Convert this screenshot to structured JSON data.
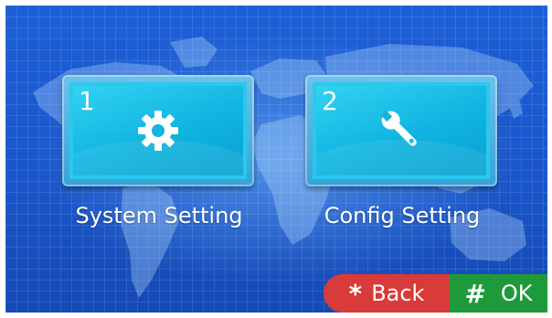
{
  "menu": {
    "items": [
      {
        "number": "1",
        "label": "System Setting",
        "icon": "gear-icon"
      },
      {
        "number": "2",
        "label": "Config Setting",
        "icon": "wrench-icon"
      }
    ]
  },
  "footer": {
    "back": {
      "key": "*",
      "label": "Back",
      "color": "#d93a3a"
    },
    "ok": {
      "key": "#",
      "label": "OK",
      "color": "#1f9a3a"
    }
  },
  "colors": {
    "background": "#1d5fd6",
    "tile": "#10b4e0"
  }
}
